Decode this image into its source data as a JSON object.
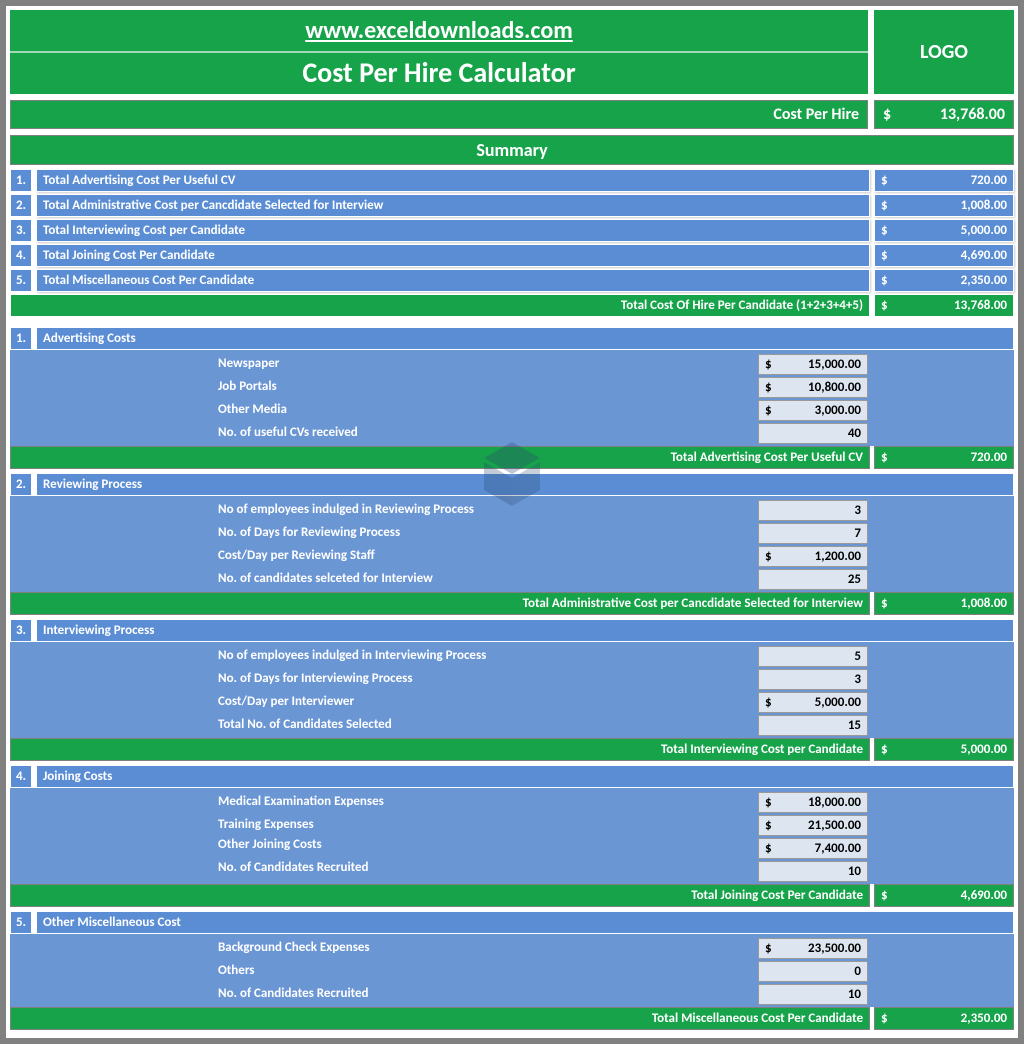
{
  "header": {
    "site": "www.exceldownloads.com",
    "title": "Cost Per Hire Calculator",
    "logo": "LOGO"
  },
  "cost_per_hire": {
    "label": "Cost Per Hire",
    "currency": "$",
    "value": "13,768.00"
  },
  "summary": {
    "title": "Summary",
    "items": [
      {
        "num": "1.",
        "label": "Total Advertising Cost Per Useful CV",
        "currency": "$",
        "value": "720.00"
      },
      {
        "num": "2.",
        "label": "Total Administrative Cost per Cancdidate Selected for Interview",
        "currency": "$",
        "value": "1,008.00"
      },
      {
        "num": "3.",
        "label": "Total Interviewing Cost per Candidate",
        "currency": "$",
        "value": "5,000.00"
      },
      {
        "num": "4.",
        "label": "Total Joining Cost Per Candidate",
        "currency": "$",
        "value": "4,690.00"
      },
      {
        "num": "5.",
        "label": "Total Miscellaneous Cost Per Candidate",
        "currency": "$",
        "value": "2,350.00"
      }
    ],
    "total": {
      "label": "Total Cost Of Hire Per Candidate (1+2+3+4+5)",
      "currency": "$",
      "value": "13,768.00"
    }
  },
  "sections": [
    {
      "num": "1.",
      "title": "Advertising Costs",
      "items": [
        {
          "label": "Newspaper",
          "currency": "$",
          "value": "15,000.00"
        },
        {
          "label": "Job Portals",
          "currency": "$",
          "value": "10,800.00"
        },
        {
          "label": "Other Media",
          "currency": "$",
          "value": "3,000.00"
        },
        {
          "label": "No. of useful CVs received",
          "currency": "",
          "value": "40"
        }
      ],
      "total": {
        "label": "Total Advertising Cost Per Useful CV",
        "currency": "$",
        "value": "720.00"
      }
    },
    {
      "num": "2.",
      "title": "Reviewing Process",
      "items": [
        {
          "label": "No of employees indulged in Reviewing Process",
          "currency": "",
          "value": "3"
        },
        {
          "label": "No. of Days for Reviewing Process",
          "currency": "",
          "value": "7"
        },
        {
          "label": "Cost/Day per Reviewing Staff",
          "currency": "$",
          "value": "1,200.00"
        },
        {
          "label": "No. of candidates selceted for Interview",
          "currency": "",
          "value": "25"
        }
      ],
      "total": {
        "label": "Total Administrative Cost per Cancdidate Selected for Interview",
        "currency": "$",
        "value": "1,008.00"
      }
    },
    {
      "num": "3.",
      "title": "Interviewing Process",
      "items": [
        {
          "label": "No of employees indulged in Interviewing Process",
          "currency": "",
          "value": "5"
        },
        {
          "label": "No. of Days for Interviewing Process",
          "currency": "",
          "value": "3"
        },
        {
          "label": "Cost/Day per Interviewer",
          "currency": "$",
          "value": "5,000.00"
        },
        {
          "label": "Total No. of Candidates Selected",
          "currency": "",
          "value": "15"
        }
      ],
      "total": {
        "label": "Total Interviewing Cost per Candidate",
        "currency": "$",
        "value": "5,000.00"
      }
    },
    {
      "num": "4.",
      "title": "Joining Costs",
      "items": [
        {
          "label": "Medical Examination Expenses",
          "currency": "$",
          "value": "18,000.00"
        },
        {
          "label": "Training Expenses",
          "currency": "$",
          "value": "21,500.00"
        },
        {
          "label": "Other Joining Costs",
          "currency": "$",
          "value": "7,400.00"
        },
        {
          "label": "No. of Candidates Recruited",
          "currency": "",
          "value": "10"
        }
      ],
      "total": {
        "label": "Total Joining Cost Per Candidate",
        "currency": "$",
        "value": "4,690.00"
      }
    },
    {
      "num": "5.",
      "title": "Other Miscellaneous Cost",
      "items": [
        {
          "label": "Background Check Expenses",
          "currency": "$",
          "value": "23,500.00"
        },
        {
          "label": "Others",
          "currency": "",
          "value": "0"
        },
        {
          "label": "No. of Candidates Recruited",
          "currency": "",
          "value": "10"
        }
      ],
      "total": {
        "label": "Total Miscellaneous Cost Per Candidate",
        "currency": "$",
        "value": "2,350.00"
      }
    }
  ]
}
